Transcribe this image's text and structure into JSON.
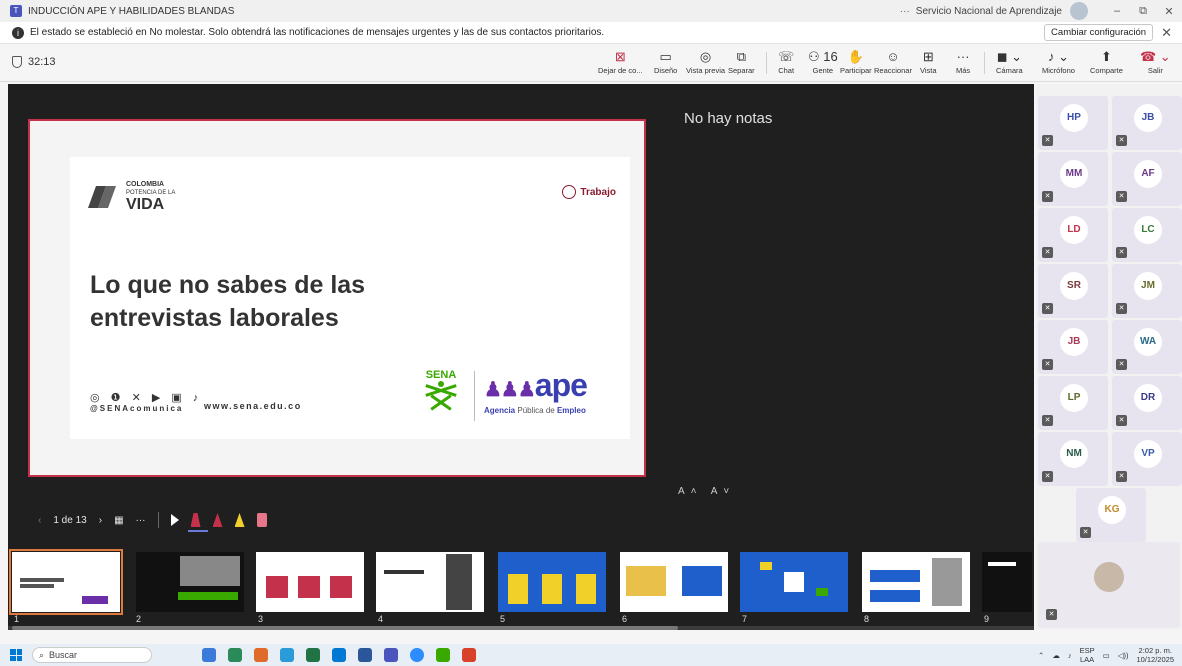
{
  "titlebar": {
    "title": "INDUCCIÓN APE Y HABILIDADES BLANDAS",
    "more": "···",
    "org": "Servicio Nacional de Aprendizaje",
    "minimize": "–",
    "restore": "⧉",
    "close": "✕"
  },
  "notification": {
    "text": "El estado se estableció en No molestar. Solo obtendrá las notificaciones de mensajes urgentes y las de sus contactos prioritarios.",
    "button": "Cambiar configuración",
    "close": "✕"
  },
  "toolbar": {
    "timer": "32:13",
    "items": [
      {
        "label": "Dejar de co...",
        "icon": "⊠"
      },
      {
        "label": "Diseño",
        "icon": "▭"
      },
      {
        "label": "Vista previa",
        "icon": "◎"
      },
      {
        "label": "Separar",
        "icon": "⧉"
      },
      {
        "label": "Chat",
        "icon": "☏"
      },
      {
        "label": "Gente",
        "icon": "⚇ 16"
      },
      {
        "label": "Participar",
        "icon": "✋"
      },
      {
        "label": "Reaccionar",
        "icon": "☺"
      },
      {
        "label": "Vista",
        "icon": "⊞"
      },
      {
        "label": "Más",
        "icon": "···"
      },
      {
        "label": "Cámara",
        "icon": "◼ ⌄"
      },
      {
        "label": "Micrófono",
        "icon": "♪ ⌄"
      },
      {
        "label": "Comparte",
        "icon": "⬆"
      },
      {
        "label": "Salir",
        "icon": "☎ ⌄"
      }
    ]
  },
  "slide": {
    "logo_top": "COLOMBIA",
    "logo_mid": "POTENCIA DE LA",
    "logo_main": "VIDA",
    "ministry": "Trabajo",
    "title": "Lo que no sabes de las entrevistas laborales",
    "social_icons": "◎ ❶ ✕ ▶ ▣ ♪",
    "handle": "@SENAcomunica",
    "url": "www.sena.edu.co",
    "sena": "SENA",
    "ape": "ape",
    "ape_sub_1": "Agencia",
    "ape_sub_2": "Pública de",
    "ape_sub_3": "Empleo"
  },
  "notes": {
    "empty": "No hay notas",
    "font_controls": "A˄ A˅"
  },
  "slide_nav": {
    "prev": "‹",
    "counter": "1 de 13",
    "next": "›",
    "grid": "▦",
    "more": "···"
  },
  "thumbnails": [
    {
      "num": "1"
    },
    {
      "num": "2"
    },
    {
      "num": "3"
    },
    {
      "num": "4"
    },
    {
      "num": "5"
    },
    {
      "num": "6"
    },
    {
      "num": "7"
    },
    {
      "num": "8"
    },
    {
      "num": "9"
    }
  ],
  "participants": [
    {
      "initials": "HP",
      "color": "#3a4fa8"
    },
    {
      "initials": "JB",
      "color": "#3a4fa8"
    },
    {
      "initials": "MM",
      "color": "#6a3a8a"
    },
    {
      "initials": "AF",
      "color": "#6a3a8a"
    },
    {
      "initials": "LD",
      "color": "#c4314b"
    },
    {
      "initials": "LC",
      "color": "#3a7a3a"
    },
    {
      "initials": "SR",
      "color": "#7a3a3a"
    },
    {
      "initials": "JM",
      "color": "#6a6a2a"
    },
    {
      "initials": "JB",
      "color": "#a83a5a"
    },
    {
      "initials": "WA",
      "color": "#2a6a8a"
    },
    {
      "initials": "LP",
      "color": "#5a6a2a"
    },
    {
      "initials": "DR",
      "color": "#3a3a8a"
    },
    {
      "initials": "NM",
      "color": "#2a5a4a"
    },
    {
      "initials": "VP",
      "color": "#3a5aa8"
    },
    {
      "initials": "KG",
      "color": "#c08a2a"
    }
  ],
  "taskbar": {
    "search": "Buscar",
    "lang1": "ESP",
    "lang2": "LAA",
    "time": "2:02 p. m.",
    "date": "10/12/2025"
  }
}
